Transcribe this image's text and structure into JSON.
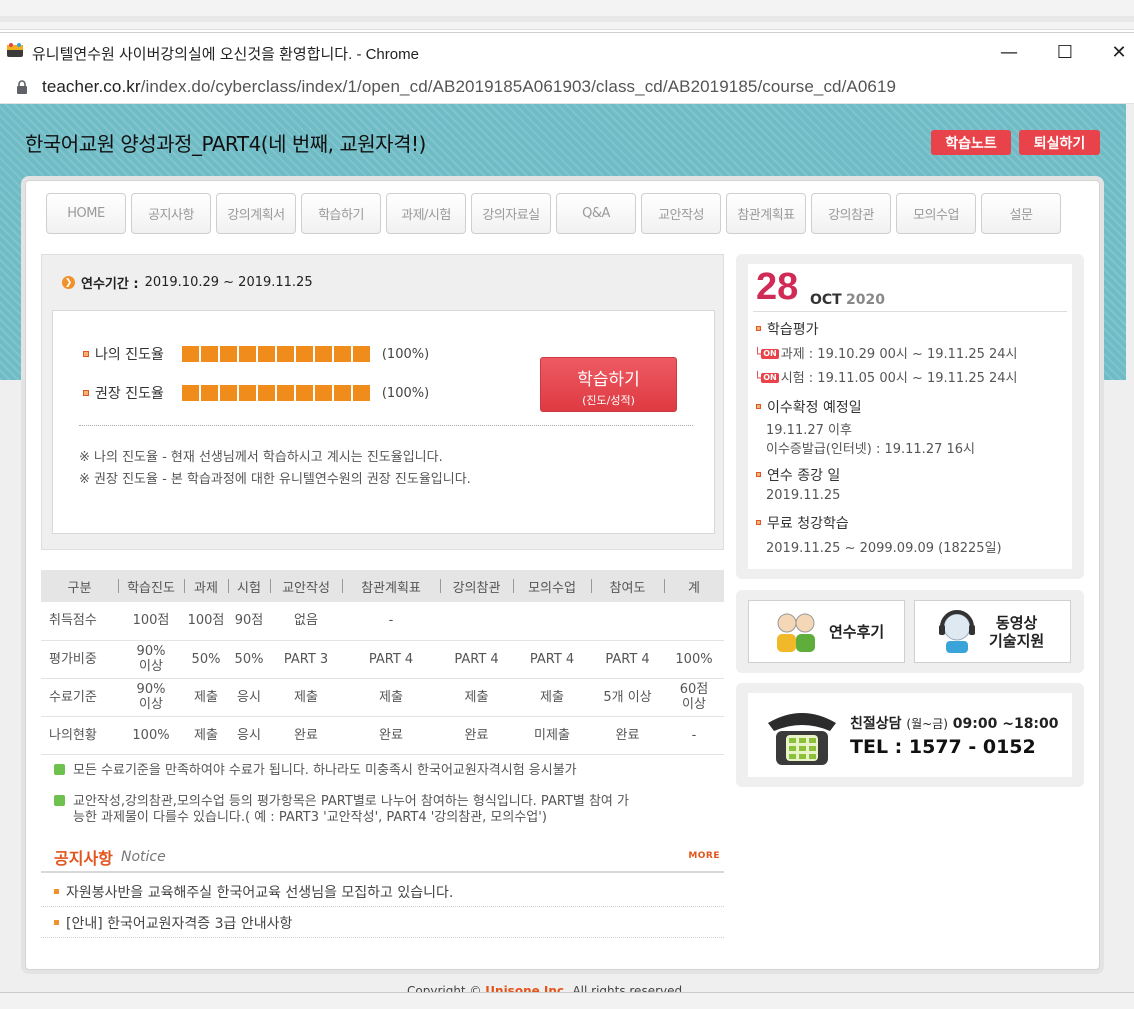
{
  "browser": {
    "window_title": "유니텔연수원 사이버강의실에 오신것을 환영합니다. - Chrome",
    "url_host": "teacher.co.kr",
    "url_path": "/index.do/cyberclass/index/1/open_cd/AB2019185A061903/class_cd/AB2019185/course_cd/A0619",
    "minimize": "—",
    "maximize": "☐",
    "close": "✕"
  },
  "header": {
    "course_title": "한국어교원 양성과정_PART4(네 번째, 교원자격!)",
    "note_button": "학습노트",
    "exit_button": "퇴실하기"
  },
  "nav": {
    "tabs": [
      "HOME",
      "공지사항",
      "강의계획서",
      "학습하기",
      "과제/시험",
      "강의자료실",
      "Q&A",
      "교안작성",
      "참관계획표",
      "강의참관",
      "모의수업",
      "설문"
    ]
  },
  "progress": {
    "period_label": "연수기간 :",
    "period_value": "2019.10.29 ~ 2019.11.25",
    "my_label": "나의 진도율",
    "my_pct": "(100%)",
    "my_value": 1.0,
    "rec_label": "권장 진도율",
    "rec_pct": "(100%)",
    "rec_value": 1.0,
    "study_button": "학습하기",
    "study_button_sub": "(진도/성적)",
    "note1": "※ 나의 진도율 - 현재 선생님께서 학습하시고 계시는 진도율입니다.",
    "note2": "※ 권장 진도율 - 본 학습과정에 대한 유니텔연수원의 권장 진도율입니다."
  },
  "grade_table": {
    "headers": [
      "구분",
      "학습진도",
      "과제",
      "시험",
      "교안작성",
      "참관계획표",
      "강의참관",
      "모의수업",
      "참여도",
      "계"
    ],
    "rows": [
      [
        "취득점수",
        "100점",
        "100점",
        "90점",
        "없음",
        "-",
        "",
        "",
        "",
        ""
      ],
      [
        "평가비중",
        "90%\n이상",
        "50%",
        "50%",
        "PART 3",
        "PART 4",
        "PART 4",
        "PART 4",
        "PART 4",
        "100%"
      ],
      [
        "수료기준",
        "90%\n이상",
        "제출",
        "응시",
        "제출",
        "제출",
        "제출",
        "제출",
        "5개 이상",
        "60점\n이상"
      ],
      [
        "나의현황",
        "100%",
        "제출",
        "응시",
        "완료",
        "완료",
        "완료",
        "미제출",
        "완료",
        "-"
      ]
    ]
  },
  "notes": {
    "n1": "모든 수료기준을 만족하여야 수료가 됩니다. 하나라도 미충족시 한국어교원자격시험 응시불가",
    "n2a": "교안작성,강의참관,모의수업 등의 평가항목은 PART별로 나누어 참여하는 형식입니다. PART별 참여 가",
    "n2b": "능한 과제물이 다를수 있습니다.( 예 : PART3 '교안작성', PART4 '강의참관, 모의수업')"
  },
  "notice": {
    "title_ko": "공지사항",
    "title_en": "Notice",
    "more": "MORE",
    "items": [
      "자원봉사반을 교육해주실 한국어교육 선생님을 모집하고 있습니다.",
      "[안내] 한국어교원자격증 3급 안내사항"
    ]
  },
  "calendar": {
    "day": "28",
    "month": "OCT",
    "year": "2020",
    "eval_title": "학습평가",
    "on_badge": "ON",
    "assignment": "과제 : 19.10.29 00시 ~ 19.11.25 24시",
    "exam": "시험 : 19.11.05 00시 ~ 19.11.25 24시",
    "complete_title": "이수확정 예정일",
    "complete_1": "19.11.27 이후",
    "complete_2": "이수증발급(인터넷) : 19.11.27 16시",
    "end_title": "연수 종강 일",
    "end_value": "2019.11.25",
    "free_title": "무료 청강학습",
    "free_value": "2019.11.25 ~ 2099.09.09 (18225일)"
  },
  "promo": {
    "review": "연수후기",
    "support_1": "동영상",
    "support_2": "기술지원"
  },
  "contact": {
    "label": "친절상담",
    "hours_days": "(월~금)",
    "hours": "09:00 ~18:00",
    "tel": "TEL : 1577 - 0152"
  },
  "footer": {
    "copyright_pre": "Copyright ©",
    "company": "Unisone Inc.",
    "copyright_post": "All rights reserved."
  },
  "colors": {
    "accent_red": "#e8434a",
    "progress_orange": "#ef8c1b",
    "teal_bg": "#6fbcc6",
    "date_pink": "#d02b57"
  }
}
